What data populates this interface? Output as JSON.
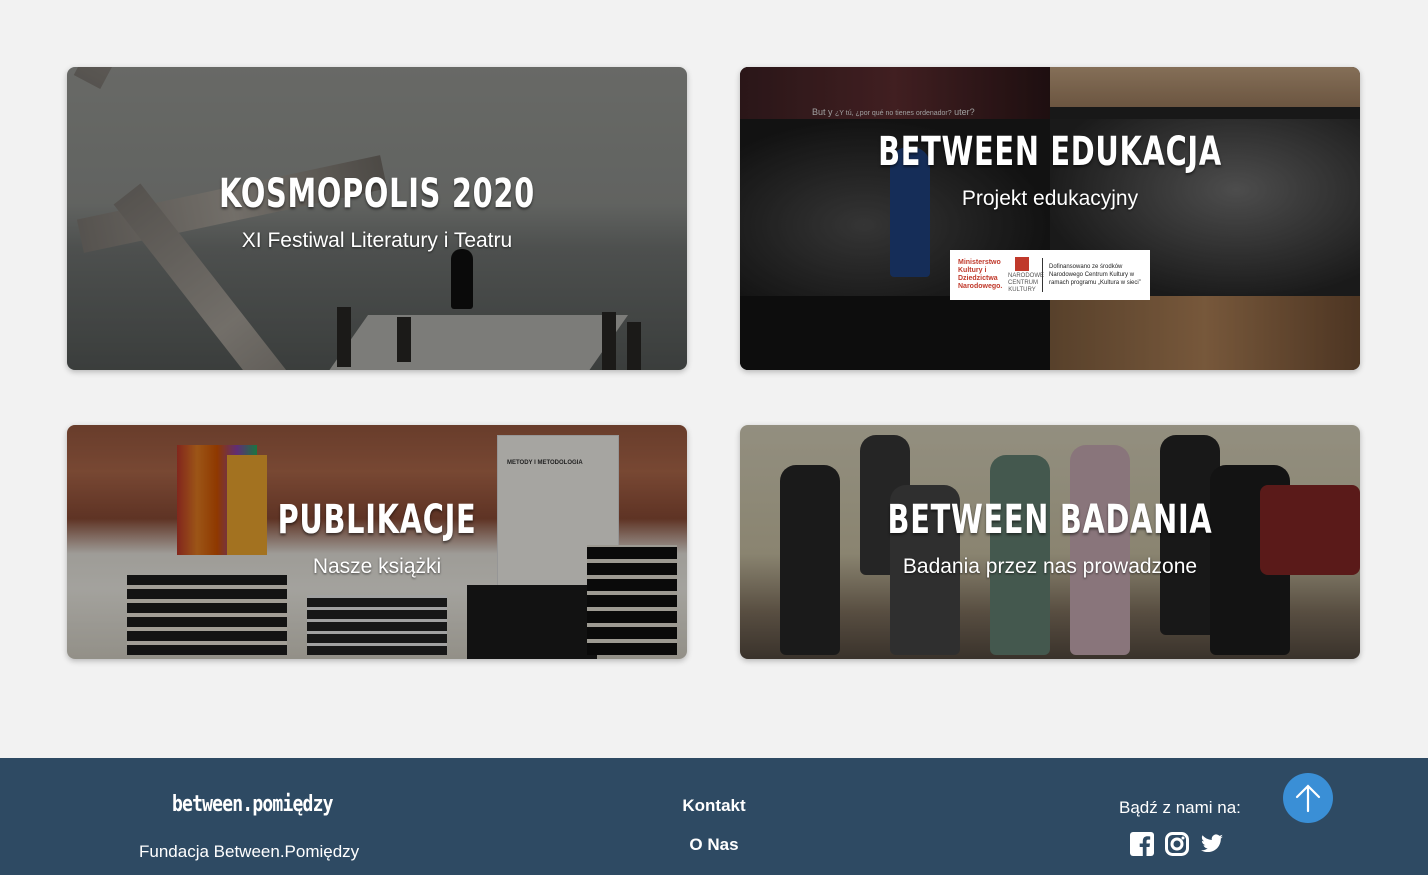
{
  "cards": [
    {
      "title": "KOSMOPOLIS 2020",
      "subtitle": "XI Festiwal Literatury i Teatru"
    },
    {
      "title": "BETWEEN EDUKACJA",
      "subtitle": "Projekt edukacyjny",
      "video_caption": "¿Y tú, ¿por qué no tienes ordenador?",
      "video_caption_left": "But y",
      "video_caption_right": "uter?",
      "sponsor": {
        "ministry": "Ministerstwo Kultury i Dziedzictwa Narodowego.",
        "nck": "NARODOWE CENTRUM KULTURY",
        "text": "Dofinansowano ze środków Narodowego Centrum Kultury w ramach programu „Kultura w sieci”"
      }
    },
    {
      "title": "PUBLIKACJE",
      "subtitle": "Nasze książki",
      "poster_title": "METODY I METODOLOGIA"
    },
    {
      "title": "BETWEEN BADANIA",
      "subtitle": "Badania przez nas prowadzone"
    }
  ],
  "footer": {
    "logo_text": "between.pomiędzy",
    "org_name": "Fundacja Between.Pomiędzy",
    "links": [
      "Kontakt",
      "O Nas"
    ],
    "social_label": "Bądź z nami na:",
    "social": [
      "facebook-icon",
      "instagram-icon",
      "twitter-icon"
    ]
  },
  "colors": {
    "footer_bg": "#2e4a63",
    "scroll_top": "#3a8fd6",
    "page_bg": "#f2f2f2"
  }
}
